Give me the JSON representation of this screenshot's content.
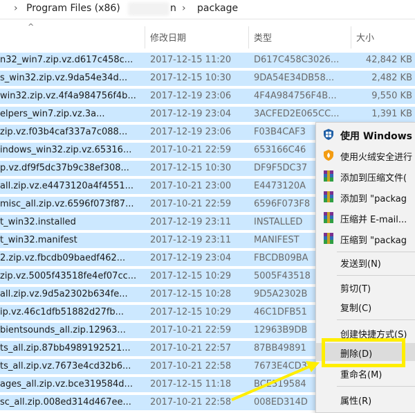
{
  "address": {
    "crumb1": "Program Files (x86)",
    "crumb2_partial": "n",
    "crumb3": "package",
    "separator": "›"
  },
  "columns": {
    "date": "修改日期",
    "type": "类型",
    "size": "大小"
  },
  "files": [
    {
      "name": "n32_win7.zip.vz.d617c458c...",
      "date": "2017-12-15 11:20",
      "type": "D617C458C3026...",
      "size": "42,842 KB"
    },
    {
      "name": "s_win32.zip.vz.9da54e34d...",
      "date": "2017-12-15 10:30",
      "type": "9DA54E34DB58...",
      "size": "2,482 KB"
    },
    {
      "name": "win32.zip.vz.4f4a984756f4b...",
      "date": "2017-12-19 23:06",
      "type": "4F4A984756F4B...",
      "size": "9,550 KB"
    },
    {
      "name": "elpers_win7.zip.vz.3a...",
      "date": "2017-12-19 23:04",
      "type": "3ACFED2E065CC...",
      "size": "1,391 KB"
    },
    {
      "name": "zip.vz.f03b4caf337a7c088...",
      "date": "2017-12-19 23:06",
      "type": "F03B4CAF3",
      "size": ""
    },
    {
      "name": "indows_win32.zip.vz.65316...",
      "date": "2017-10-21 22:59",
      "type": "653166C46",
      "size": ""
    },
    {
      "name": "p.vz.df9f5dc37b9c38ef308...",
      "date": "2017-12-15 10:30",
      "type": "DF9F5DC37",
      "size": ""
    },
    {
      "name": "all.zip.vz.e4473120a4f4551...",
      "date": "2017-10-21 23:00",
      "type": "E4473120A",
      "size": ""
    },
    {
      "name": "misc_all.zip.vz.6596f073f87...",
      "date": "2017-10-21 22:59",
      "type": "6596F073F8",
      "size": ""
    },
    {
      "name": "t_win32.installed",
      "date": "2017-12-19 23:11",
      "type": "INSTALLED",
      "size": ""
    },
    {
      "name": "t_win32.manifest",
      "date": "2017-12-19 23:11",
      "type": "MANIFEST",
      "size": ""
    },
    {
      "name": "2.zip.vz.fbcdb09baedf462...",
      "date": "2017-12-19 23:04",
      "type": "FBCDB09BA",
      "size": ""
    },
    {
      "name": "zip.vz.5005f43518fe4ef07cc...",
      "date": "2017-12-15 10:29",
      "type": "5005F43518",
      "size": ""
    },
    {
      "name": "all.zip.vz.9d5a2302b634fe...",
      "date": "2017-12-15 10:28",
      "type": "9D5A2302B",
      "size": ""
    },
    {
      "name": "ip.vz.46c1dfb51882d27fb...",
      "date": "2017-12-15 10:29",
      "type": "46C1DFB51",
      "size": ""
    },
    {
      "name": "bientsounds_all.zip.12963...",
      "date": "2017-10-21 22:59",
      "type": "12963B9DB",
      "size": ""
    },
    {
      "name": "ts_all.zip.87bb4989192521...",
      "date": "2017-10-21 22:57",
      "type": "87BB49891",
      "size": ""
    },
    {
      "name": "ts_all.zip.vz.7673e4cd32b6...",
      "date": "2017-10-21 22:58",
      "type": "7673E4CD3",
      "size": ""
    },
    {
      "name": "ages_all.zip.vz.bce319584d...",
      "date": "2017-12-15 11:18",
      "type": "BCE319584",
      "size": ""
    },
    {
      "name": "sc_all.zip.008ed314d467ee...",
      "date": "2017-10-21 22:58",
      "type": "008ED314D",
      "size": ""
    }
  ],
  "context_menu": {
    "items": [
      {
        "label": "使用 Windows",
        "icon": "windows-defender-icon"
      },
      {
        "label": "使用火绒安全进行",
        "icon": "huorong-shield-icon"
      },
      {
        "label": "添加到压缩文件(",
        "icon": "winrar-icon"
      },
      {
        "label": "添加到 \"packag",
        "icon": "winrar-icon"
      },
      {
        "label": "压缩并 E-mail...",
        "icon": "winrar-icon"
      },
      {
        "label": "压缩到 \"packag",
        "icon": "winrar-icon"
      },
      {
        "label": "发送到(N)"
      },
      {
        "label": "剪切(T)"
      },
      {
        "label": "复制(C)"
      },
      {
        "label": "创建快捷方式(S)"
      },
      {
        "label": "删除(D)"
      },
      {
        "label": "重命名(M)"
      },
      {
        "label": "属性(R)"
      }
    ]
  },
  "colors": {
    "selection": "#cce8ff",
    "annotation": "#ffee00"
  }
}
